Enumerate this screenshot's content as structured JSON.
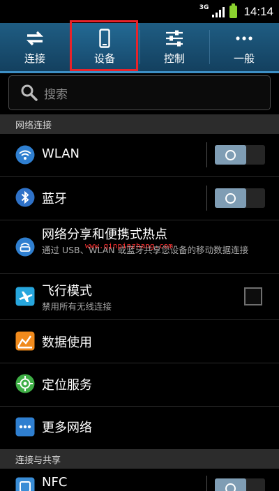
{
  "status": {
    "network": "3G",
    "time": "14:14"
  },
  "tabs": [
    {
      "label": "连接",
      "icon": "connection-arrows-icon"
    },
    {
      "label": "设备",
      "icon": "phone-device-icon",
      "selected": true
    },
    {
      "label": "控制",
      "icon": "sliders-control-icon"
    },
    {
      "label": "一般",
      "icon": "more-dots-icon"
    }
  ],
  "search": {
    "placeholder": "搜索"
  },
  "sections": {
    "network": "网络连接",
    "connect_share": "连接与共享"
  },
  "rows": {
    "wlan": {
      "title": "WLAN",
      "icon": "wifi-icon",
      "toggle": false
    },
    "bluetooth": {
      "title": "蓝牙",
      "icon": "bluetooth-icon",
      "toggle": false
    },
    "hotspot": {
      "title": "网络分享和便携式热点",
      "subtitle": "通过 USB、WLAN 或蓝牙共享您设备的移动数据连接",
      "icon": "router-hotspot-icon"
    },
    "flight": {
      "title": "飞行模式",
      "subtitle": "禁用所有无线连接",
      "icon": "airplane-icon",
      "checked": false
    },
    "data": {
      "title": "数据使用",
      "icon": "data-usage-chart-icon"
    },
    "location": {
      "title": "定位服务",
      "icon": "location-target-icon"
    },
    "more": {
      "title": "更多网络",
      "icon": "more-networks-icon"
    },
    "nfc": {
      "title": "NFC",
      "icon": "nfc-icon",
      "toggle": false
    }
  },
  "watermark": "www.qinpinzhang.com",
  "colors": {
    "tabbar": "#1a5177",
    "accent": "#3d8fc5",
    "highlight": "#e8232a",
    "toggle": "#7f9db4"
  }
}
